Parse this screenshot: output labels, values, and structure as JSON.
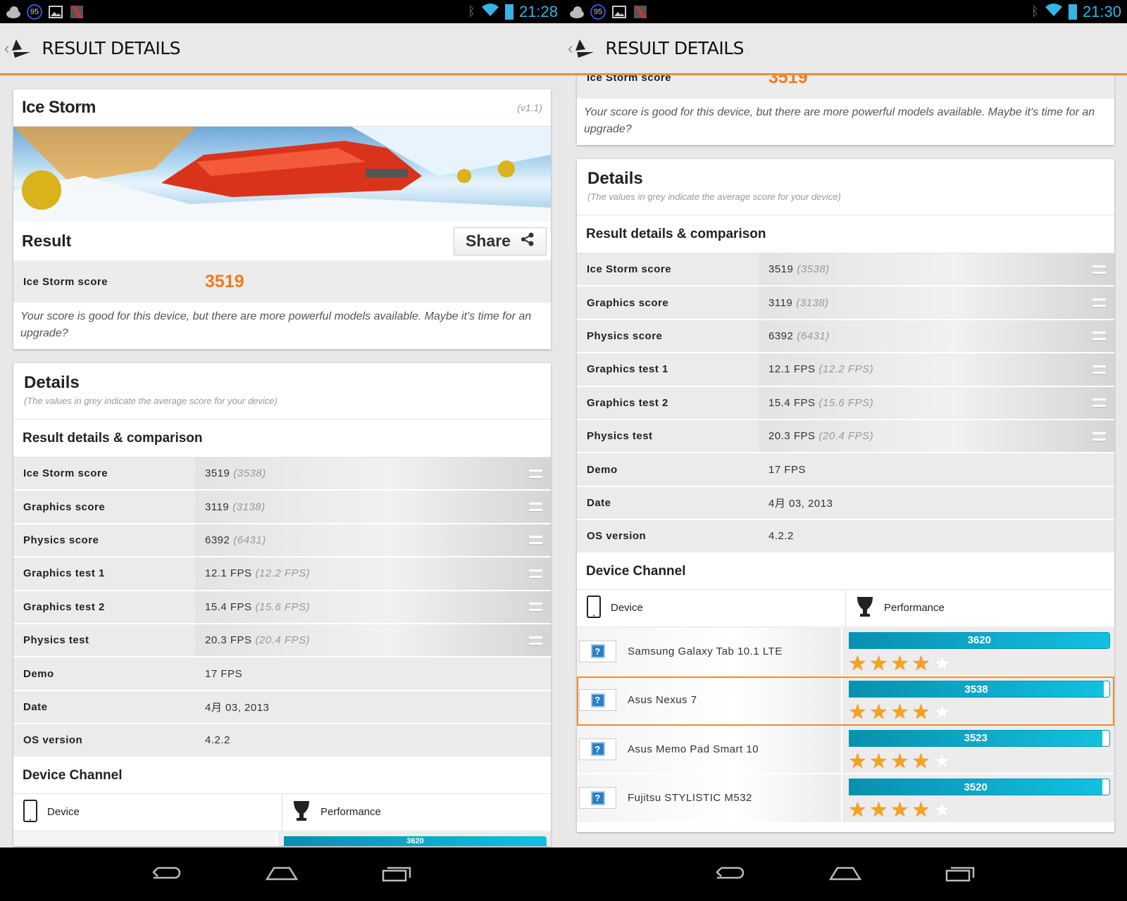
{
  "screens": [
    {
      "status": {
        "time": "21:28",
        "notification_badge": "95"
      }
    },
    {
      "status": {
        "time": "21:30",
        "notification_badge": "95"
      }
    }
  ],
  "app_bar": {
    "title": "RESULT DETAILS"
  },
  "test_card": {
    "title": "Ice Storm",
    "version": "(v1.1)",
    "result_heading": "Result",
    "share_label": "Share",
    "score_label": "Ice Storm score",
    "score_value": "3519",
    "description": "Your score is good for this device, but there are more powerful models available. Maybe it's time for an upgrade?"
  },
  "details": {
    "title": "Details",
    "subtitle": "(The values in grey indicate the average score for your device)",
    "section_title": "Result details & comparison",
    "rows": [
      {
        "label": "Ice Storm score",
        "value": "3519",
        "average": "(3538)"
      },
      {
        "label": "Graphics score",
        "value": "3119",
        "average": "(3138)"
      },
      {
        "label": "Physics score",
        "value": "6392",
        "average": "(6431)"
      },
      {
        "label": "Graphics test 1",
        "value": "12.1 FPS",
        "average": "(12.2 FPS)"
      },
      {
        "label": "Graphics test 2",
        "value": "15.4 FPS",
        "average": "(15.6 FPS)"
      },
      {
        "label": "Physics test",
        "value": "20.3 FPS",
        "average": "(20.4 FPS)"
      },
      {
        "label": "Demo",
        "value": "17 FPS"
      },
      {
        "label": "Date",
        "value": "4月 03, 2013"
      },
      {
        "label": "OS version",
        "value": "4.2.2"
      }
    ]
  },
  "device_channel": {
    "title": "Device Channel",
    "col_device": "Device",
    "col_performance": "Performance",
    "max_score": 3620,
    "devices": [
      {
        "name": "Samsung Galaxy Tab 10.1 LTE",
        "score": 3620,
        "stars": 4,
        "current": false
      },
      {
        "name": "Asus Nexus 7",
        "score": 3538,
        "stars": 4,
        "current": true
      },
      {
        "name": "Asus Memo Pad Smart 10",
        "score": 3523,
        "stars": 4,
        "current": false
      },
      {
        "name": "Fujitsu STYLISTIC M532",
        "score": 3520,
        "stars": 4,
        "current": false
      }
    ]
  },
  "colors": {
    "accent": "#f08a2c",
    "score": "#f27a1a",
    "bar": "#12c0e0"
  }
}
